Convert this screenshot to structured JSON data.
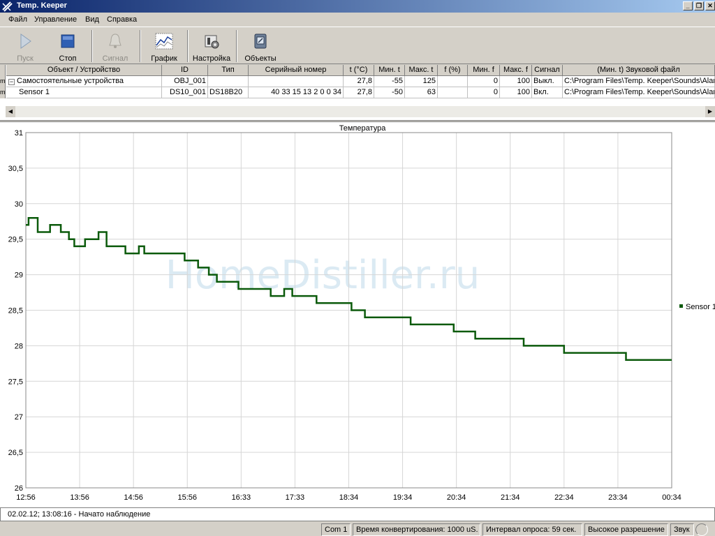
{
  "window": {
    "title": "Temp. Keeper"
  },
  "menu": [
    "Файл",
    "Управление",
    "Вид",
    "Справка"
  ],
  "toolbar": {
    "buttons": [
      {
        "label": "Пуск",
        "icon": "play-icon",
        "enabled": false
      },
      {
        "label": "Стоп",
        "icon": "stop-icon",
        "enabled": true
      },
      {
        "label": "Сигнал",
        "icon": "bell-icon",
        "enabled": false
      },
      {
        "label": "График",
        "icon": "chart-icon",
        "enabled": true
      },
      {
        "label": "Настройка",
        "icon": "settings-icon",
        "enabled": true
      },
      {
        "label": "Объекты",
        "icon": "objects-icon",
        "enabled": true
      }
    ]
  },
  "grid": {
    "left_marks": [
      "m",
      "m"
    ],
    "columns": [
      "Объект / Устройство",
      "ID",
      "Тип",
      "Серийный номер",
      "t (°C)",
      "Мин. t",
      "Макс. t",
      "f (%)",
      "Мин. f",
      "Макс. f",
      "Сигнал",
      "(Мин. t) Звуковой файл"
    ],
    "rows": [
      [
        "Самостоятельные устройства",
        "OBJ_001",
        "",
        "",
        "27,8",
        "-55",
        "125",
        "",
        "0",
        "100",
        "Выкл.",
        "C:\\Program Files\\Temp. Keeper\\Sounds\\Alar"
      ],
      [
        "Sensor 1",
        "DS10_001",
        "DS18B20",
        "40 33 15 13 2 0 0 34",
        "27,8",
        "-50",
        "63",
        "",
        "0",
        "100",
        "Вкл.",
        "C:\\Program Files\\Temp. Keeper\\Sounds\\Alar"
      ]
    ]
  },
  "chart_data": {
    "type": "line",
    "title": "Температура",
    "watermark": "HomeDistiller.ru",
    "x_labels": [
      "12:56",
      "13:56",
      "14:56",
      "15:56",
      "16:33",
      "17:33",
      "18:34",
      "19:34",
      "20:34",
      "21:34",
      "22:34",
      "23:34",
      "00:34"
    ],
    "ylim": [
      26,
      31
    ],
    "y_ticks": [
      "26",
      "26,5",
      "27",
      "27,5",
      "28",
      "28,5",
      "29",
      "29,5",
      "30",
      "30,5",
      "31"
    ],
    "grid": true,
    "legend_position": "right",
    "series": [
      {
        "name": "Sensor 1",
        "color": "#0b5a0b",
        "points": [
          [
            0.0,
            29.7
          ],
          [
            0.05,
            29.7
          ],
          [
            0.05,
            29.8
          ],
          [
            0.22,
            29.8
          ],
          [
            0.22,
            29.6
          ],
          [
            0.45,
            29.6
          ],
          [
            0.45,
            29.7
          ],
          [
            0.65,
            29.7
          ],
          [
            0.65,
            29.6
          ],
          [
            0.8,
            29.6
          ],
          [
            0.8,
            29.5
          ],
          [
            0.9,
            29.5
          ],
          [
            0.9,
            29.4
          ],
          [
            1.1,
            29.4
          ],
          [
            1.1,
            29.5
          ],
          [
            1.35,
            29.5
          ],
          [
            1.35,
            29.6
          ],
          [
            1.5,
            29.6
          ],
          [
            1.5,
            29.4
          ],
          [
            1.85,
            29.4
          ],
          [
            1.85,
            29.3
          ],
          [
            2.1,
            29.3
          ],
          [
            2.1,
            29.4
          ],
          [
            2.2,
            29.4
          ],
          [
            2.2,
            29.3
          ],
          [
            2.95,
            29.3
          ],
          [
            2.95,
            29.2
          ],
          [
            3.2,
            29.2
          ],
          [
            3.2,
            29.1
          ],
          [
            3.4,
            29.1
          ],
          [
            3.4,
            29.0
          ],
          [
            3.55,
            29.0
          ],
          [
            3.55,
            28.9
          ],
          [
            3.95,
            28.9
          ],
          [
            3.95,
            28.8
          ],
          [
            4.55,
            28.8
          ],
          [
            4.55,
            28.7
          ],
          [
            4.8,
            28.7
          ],
          [
            4.8,
            28.8
          ],
          [
            4.95,
            28.8
          ],
          [
            4.95,
            28.7
          ],
          [
            5.4,
            28.7
          ],
          [
            5.4,
            28.6
          ],
          [
            6.05,
            28.6
          ],
          [
            6.05,
            28.5
          ],
          [
            6.3,
            28.5
          ],
          [
            6.3,
            28.4
          ],
          [
            7.15,
            28.4
          ],
          [
            7.15,
            28.3
          ],
          [
            7.95,
            28.3
          ],
          [
            7.95,
            28.2
          ],
          [
            8.35,
            28.2
          ],
          [
            8.35,
            28.1
          ],
          [
            9.25,
            28.1
          ],
          [
            9.25,
            28.0
          ],
          [
            10.0,
            28.0
          ],
          [
            10.0,
            27.9
          ],
          [
            11.15,
            27.9
          ],
          [
            11.15,
            27.8
          ],
          [
            12.0,
            27.8
          ]
        ]
      }
    ]
  },
  "log": {
    "line": "02.02.12; 13:08:16 - Начато наблюдение"
  },
  "status": {
    "port": "Com 1",
    "conversion": "Время конвертирования: 1000 uS.",
    "interval": "Интервал опроса: 59 сек.",
    "resolution": "Высокое разрешение",
    "sound": "Звук"
  }
}
